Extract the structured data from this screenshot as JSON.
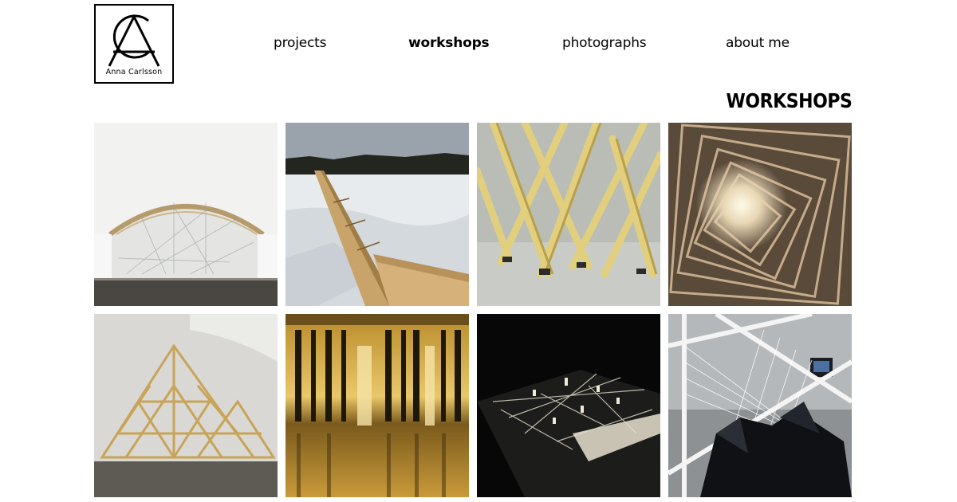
{
  "logo": {
    "name": "Anna Carlsson"
  },
  "nav": {
    "items": [
      {
        "label": "projects"
      },
      {
        "label": "workshops"
      },
      {
        "label": "photographs"
      },
      {
        "label": "about me"
      }
    ],
    "active_index": 1
  },
  "page": {
    "title": "WORKSHOPS"
  },
  "colors": {
    "text": "#000000",
    "background": "#ffffff"
  }
}
